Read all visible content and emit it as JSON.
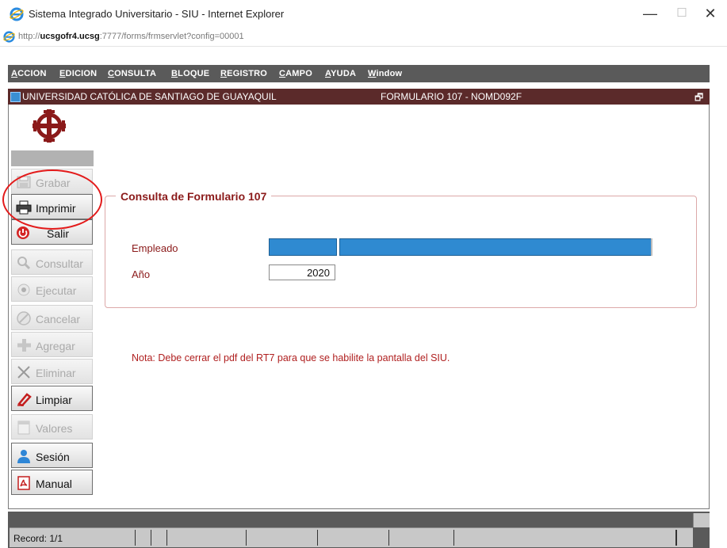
{
  "window": {
    "title": "Sistema Integrado Universitario - SIU - Internet Explorer",
    "minimize_glyph": "—",
    "maximize_glyph": "☐",
    "close_glyph": "✕"
  },
  "address": {
    "prefix": "http://",
    "host": "ucsgofr4.ucsg",
    "rest": ":7777/forms/frmservlet?config=00001"
  },
  "menu": {
    "items": [
      {
        "u": "A",
        "rest": "CCION"
      },
      {
        "u": "E",
        "rest": "DICION"
      },
      {
        "u": "C",
        "rest": "ONSULTA"
      },
      {
        "u": "B",
        "rest": "LOQUE"
      },
      {
        "u": "R",
        "rest": "EGISTRO"
      },
      {
        "u": "C",
        "rest": "AMPO"
      },
      {
        "u": "A",
        "rest": "YUDA"
      },
      {
        "u": "W",
        "rest": "indow"
      }
    ]
  },
  "form_header": {
    "left": "UNIVERSIDAD CATÓLICA DE SANTIAGO DE GUAYAQUIL",
    "right": "FORMULARIO 107 - NOMD092F",
    "restore_glyph": "🗗"
  },
  "toolbar": {
    "buttons": [
      {
        "label": "Grabar",
        "icon": "save-icon"
      },
      {
        "label": "Imprimir",
        "icon": "printer-icon"
      },
      {
        "label": "Salir",
        "icon": "exit-icon"
      },
      {
        "label": "Consultar",
        "icon": "magnifier-icon"
      },
      {
        "label": "Ejecutar",
        "icon": "execute-icon"
      },
      {
        "label": "Cancelar",
        "icon": "cancel-icon"
      },
      {
        "label": "Agregar",
        "icon": "plus-icon"
      },
      {
        "label": "Eliminar",
        "icon": "x-icon"
      },
      {
        "label": "Limpiar",
        "icon": "eraser-icon"
      },
      {
        "label": "Valores",
        "icon": "list-icon"
      },
      {
        "label": "Sesión",
        "icon": "user-icon"
      },
      {
        "label": "Manual",
        "icon": "pdf-icon"
      }
    ]
  },
  "main": {
    "frame_title": "Consulta de Formulario 107",
    "empleado_label": "Empleado",
    "anio_label": "Año",
    "anio_value": "2020",
    "nota": "Nota: Debe cerrar el pdf del RT7 para que se habilite la pantalla del SIU."
  },
  "status": {
    "record": "Record: 1/1"
  },
  "colors": {
    "menu_bg": "#5a5a5a",
    "header_bg": "#5b2a2a",
    "label_red": "#8b1a1a",
    "field_blue": "#2f8ad1",
    "annotation_red": "#e31b1b"
  }
}
